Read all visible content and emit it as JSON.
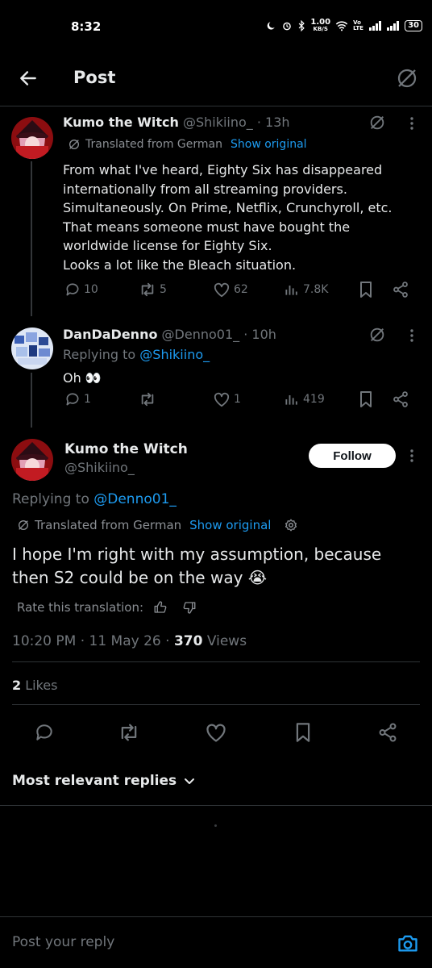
{
  "status_bar": {
    "time": "8:32",
    "net_speed": "1.00",
    "net_unit": "KB/S",
    "volte": "Vo LTE",
    "battery": "30"
  },
  "header": {
    "title": "Post"
  },
  "tweets": [
    {
      "name": "Kumo the Witch",
      "handle": "@Shikiino_",
      "time": "· 13h",
      "translated": "Translated from German",
      "show_original": "Show original",
      "text": "From what I've heard, Eighty Six has disappeared internationally from all streaming providers. Simultaneously. On Prime, Netflix, Crunchyroll, etc. That means someone must have bought the worldwide license for Eighty Six.\nLooks a lot like the Bleach situation.",
      "replies": "10",
      "reposts": "5",
      "likes": "62",
      "views": "7.8K"
    },
    {
      "name": "DanDaDenno",
      "handle": "@Denno01_",
      "time": "· 10h",
      "replying_prefix": "Replying to ",
      "replying_handle": "@Shikiino_",
      "text": "Oh 👀",
      "replies": "1",
      "reposts": "",
      "likes": "1",
      "views": "419"
    }
  ],
  "main_post": {
    "name": "Kumo the Witch",
    "handle": "@Shikiino_",
    "follow_label": "Follow",
    "replying_prefix": "Replying to ",
    "replying_handle": "@Denno01_",
    "translated": "Translated from German",
    "show_original": "Show original",
    "text": "I hope I'm right with my assumption, because then S2 could be on the way 😭",
    "rate_label": "Rate this translation:",
    "timestamp": "10:20 PM · 11 May 26 · ",
    "views_count": "370",
    "views_label": " Views",
    "likes_count": "2",
    "likes_label": " Likes"
  },
  "replies_section": {
    "sort_label": "Most relevant replies"
  },
  "composer": {
    "placeholder": "Post your reply"
  },
  "colors": {
    "accent": "#1d9bf0",
    "background": "#000000",
    "muted": "#71767b",
    "divider": "#2f3336",
    "text": "#e7e9ea"
  },
  "icons": [
    "back-arrow-icon",
    "grok-icon",
    "more-icon",
    "translate-icon",
    "reply-icon",
    "repost-icon",
    "like-icon",
    "views-icon",
    "bookmark-icon",
    "share-icon",
    "settings-icon",
    "thumbs-up-icon",
    "thumbs-down-icon",
    "chevron-down-icon",
    "camera-icon"
  ]
}
